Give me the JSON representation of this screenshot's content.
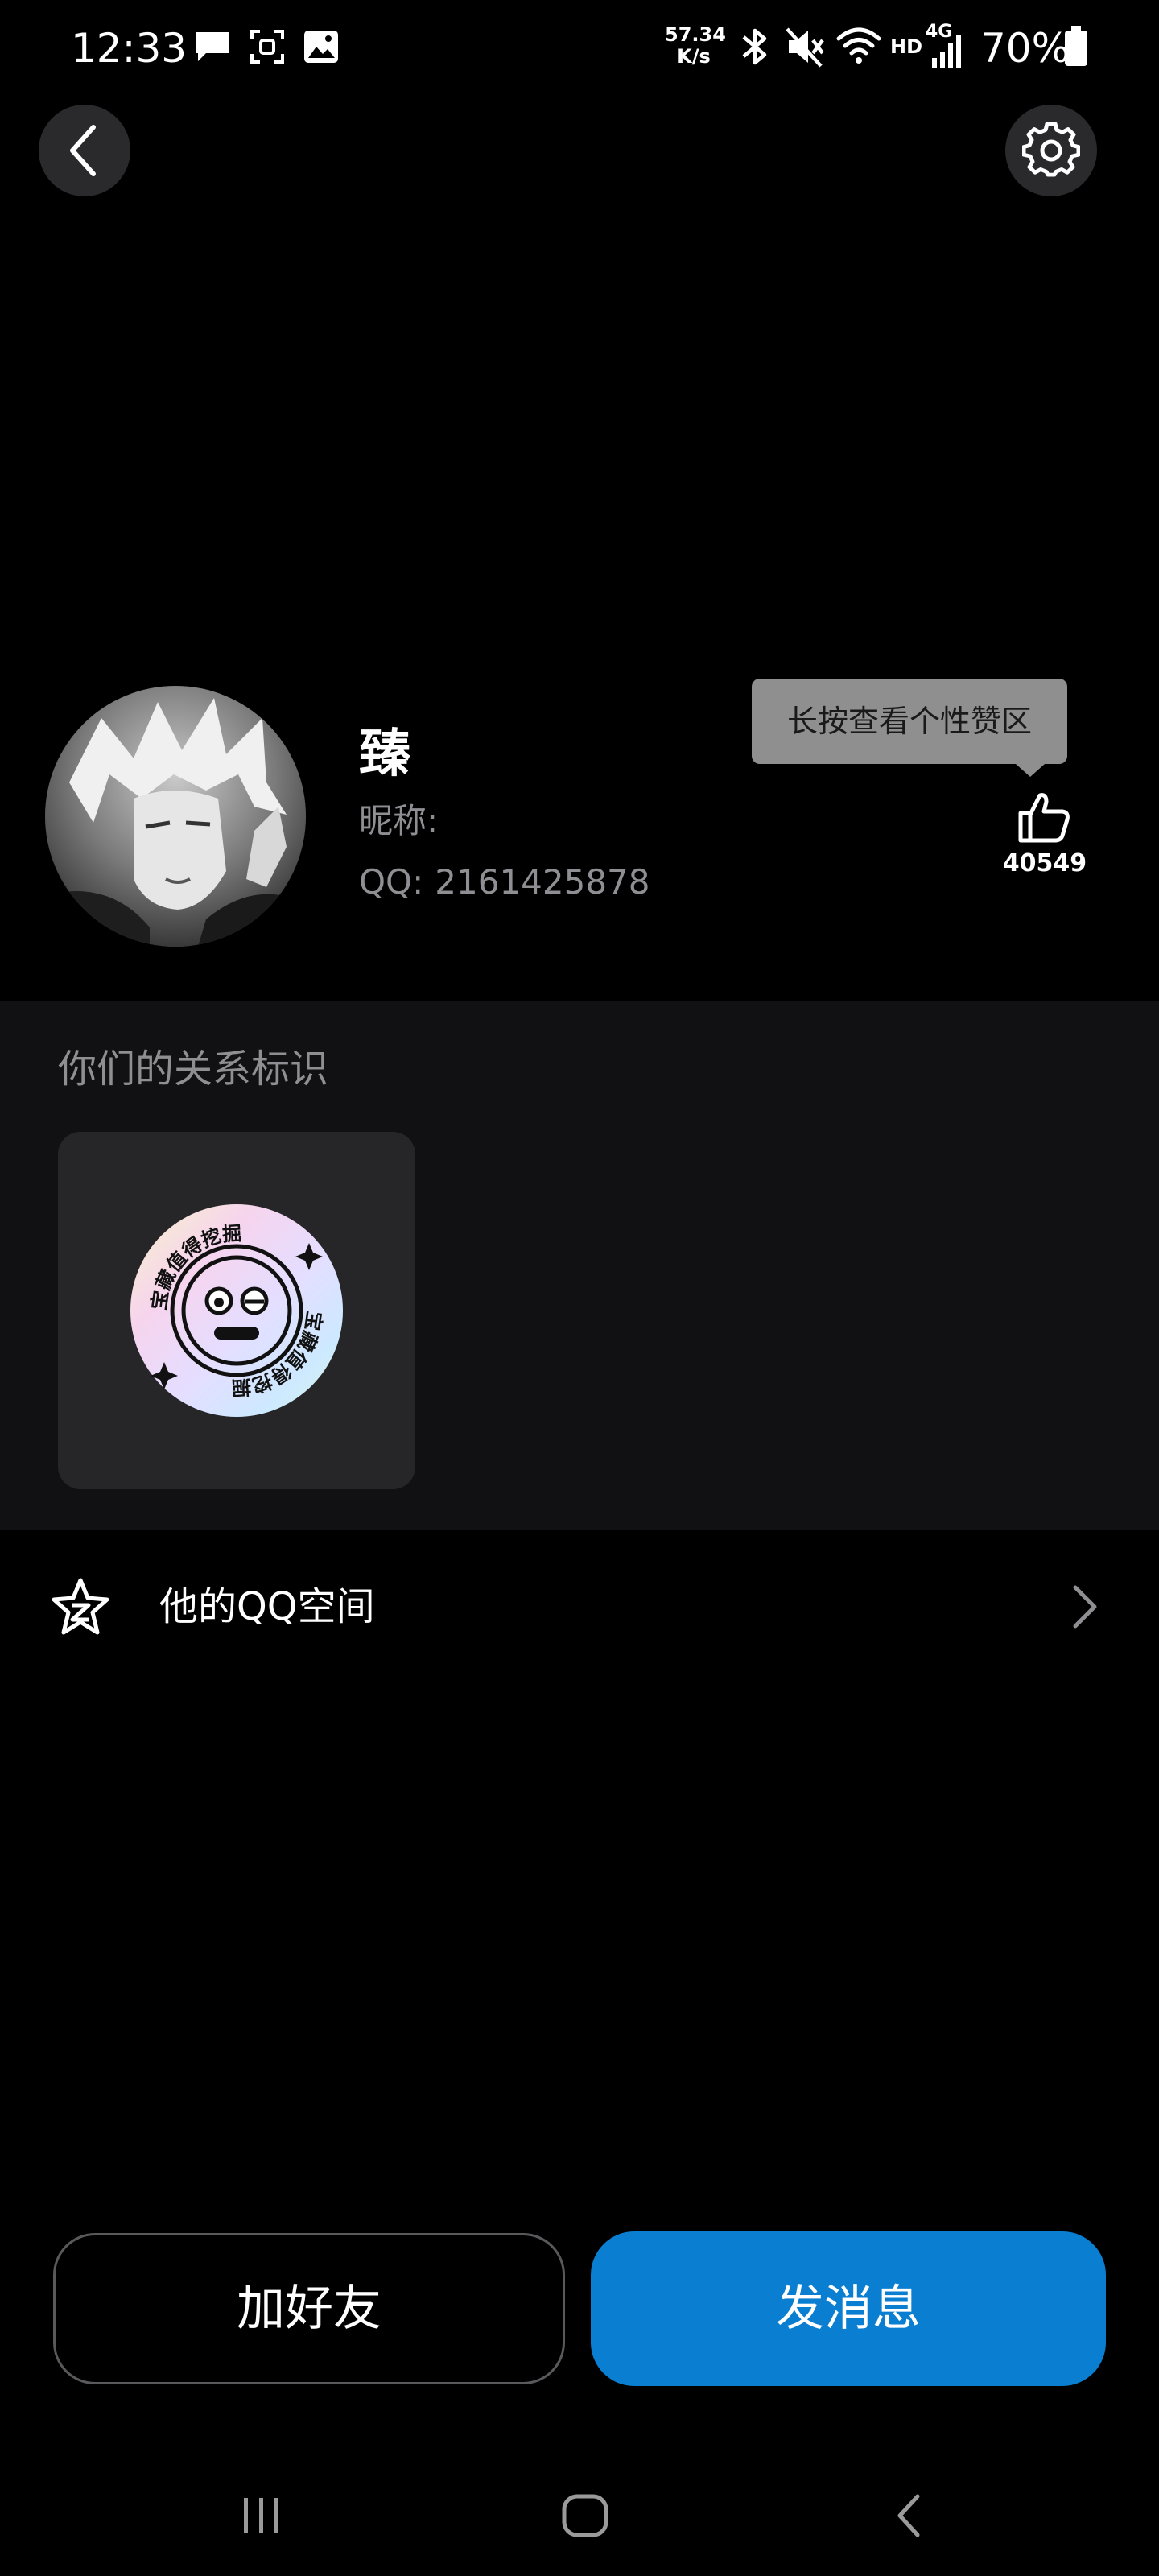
{
  "status_bar": {
    "time": "12:33",
    "net_speed_value": "57.34",
    "net_speed_unit": "K/s",
    "hd_label": "HD",
    "network_label": "4G",
    "battery_percent": "70%",
    "icons": [
      "message-icon",
      "screenshot-icon",
      "image-icon",
      "bluetooth-icon",
      "mute-icon",
      "wifi-icon",
      "signal-icon",
      "battery-icon"
    ]
  },
  "nav": {
    "back_icon": "chevron-left-icon",
    "settings_icon": "gear-icon"
  },
  "profile": {
    "name": "臻",
    "nickname_label": "昵称:",
    "qq_label": "QQ:",
    "qq_number": "2161425878",
    "like_tooltip": "长按查看个性赞区",
    "like_count": "40549",
    "like_icon": "thumbs-up-icon"
  },
  "relationship": {
    "title": "你们的关系标识",
    "badge_text": "宝藏值得挖掘"
  },
  "qzone": {
    "label": "他的QQ空间",
    "icon": "qzone-star-icon"
  },
  "actions": {
    "add_friend_label": "加好友",
    "send_message_label": "发消息"
  },
  "colors": {
    "background": "#000000",
    "section_background": "#111113",
    "card_background": "#262628",
    "primary_button": "#0a7ed0",
    "secondary_text": "#8e8e93",
    "tooltip_background": "#8f8f8f"
  }
}
